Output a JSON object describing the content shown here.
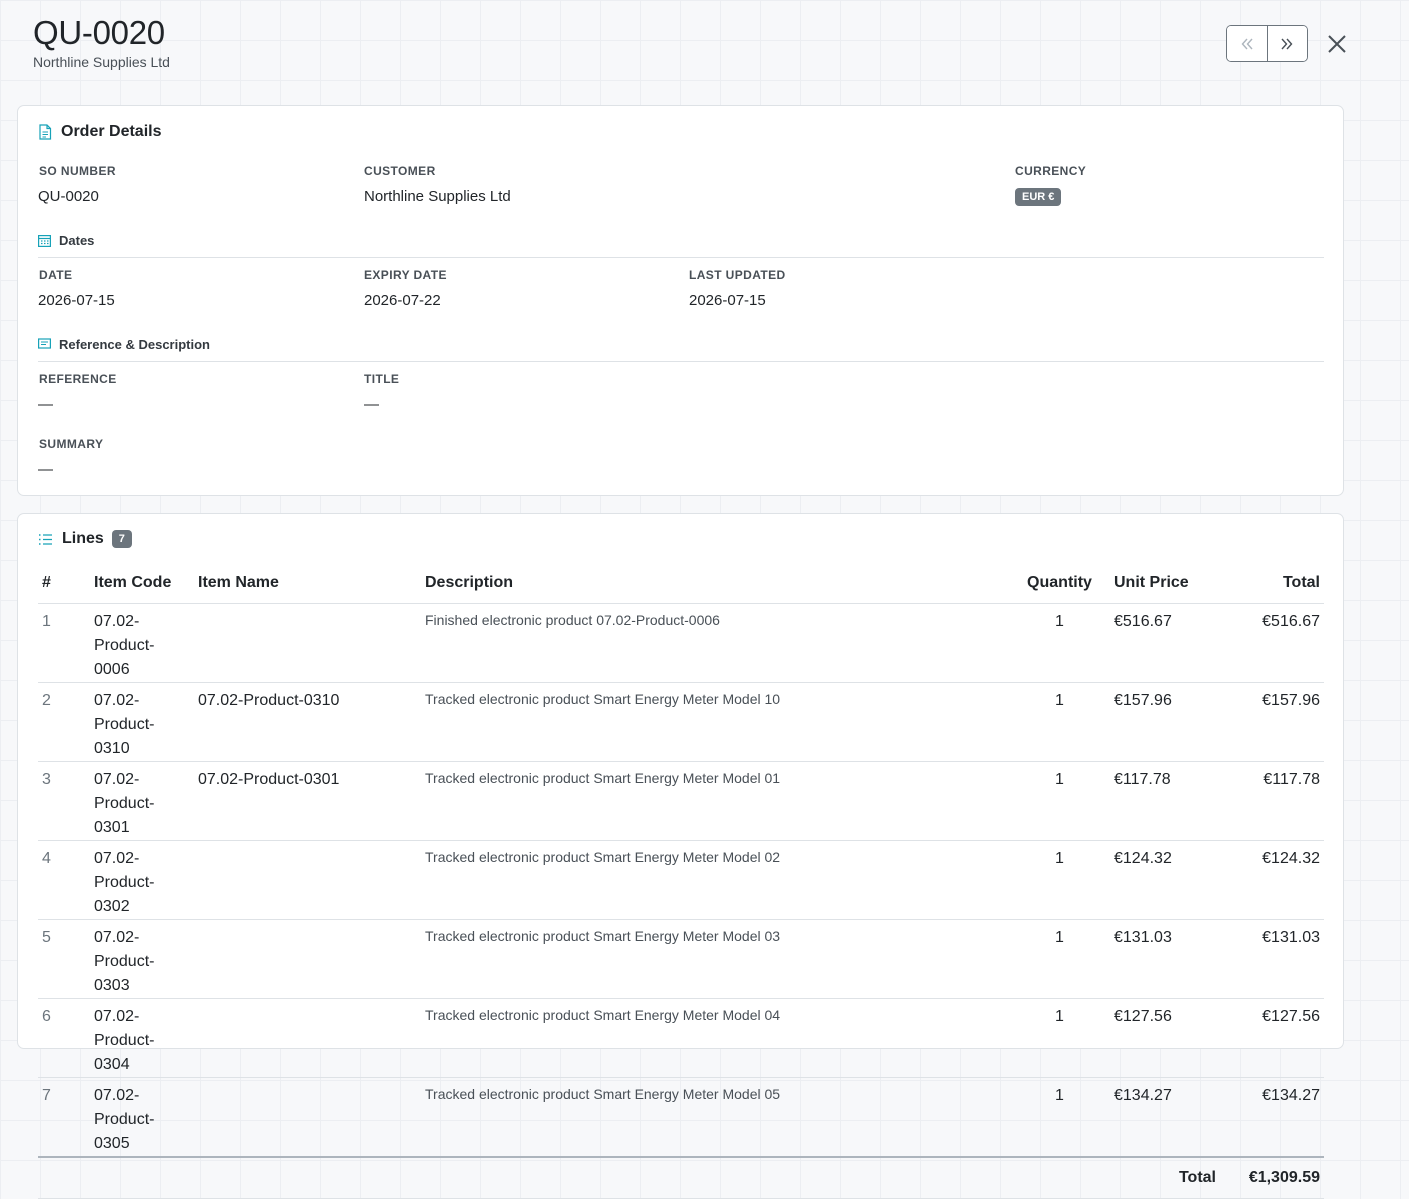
{
  "header": {
    "title": "QU-0020",
    "subtitle": "Northline Supplies Ltd"
  },
  "icons": {
    "prev": "chevrons-left-icon",
    "next": "chevrons-right-icon",
    "close": "close-icon",
    "order_details": "document-icon",
    "dates": "calendar-icon",
    "reference": "message-icon",
    "lines": "list-icon"
  },
  "colors": {
    "accent": "#17a2b8",
    "badge": "#6c757d"
  },
  "order_details": {
    "title": "Order Details",
    "so_number": {
      "label": "SO NUMBER",
      "value": "QU-0020"
    },
    "customer": {
      "label": "CUSTOMER",
      "value": "Northline Supplies Ltd"
    },
    "currency": {
      "label": "CURRENCY",
      "value": "EUR €"
    },
    "dates": {
      "title": "Dates",
      "date": {
        "label": "DATE",
        "value": "2026-07-15"
      },
      "expiry": {
        "label": "EXPIRY DATE",
        "value": "2026-07-22"
      },
      "updated": {
        "label": "LAST UPDATED",
        "value": "2026-07-15"
      }
    },
    "reference_section": {
      "title": "Reference & Description",
      "reference": {
        "label": "REFERENCE",
        "value": "—"
      },
      "title_field": {
        "label": "TITLE",
        "value": "—"
      },
      "summary": {
        "label": "SUMMARY",
        "value": "—"
      }
    }
  },
  "lines": {
    "title": "Lines",
    "count": "7",
    "columns": [
      "#",
      "Item Code",
      "Item Name",
      "Description",
      "Quantity",
      "Unit Price",
      "Total"
    ],
    "rows": [
      {
        "num": "1",
        "code": "07.02-Product-0006",
        "name": "",
        "desc": "Finished electronic product 07.02-Product-0006",
        "qty": "1",
        "price": "€516.67",
        "total": "€516.67"
      },
      {
        "num": "2",
        "code": "07.02-Product-0310",
        "name": "07.02-Product-0310",
        "desc": "Tracked electronic product Smart Energy Meter Model 10",
        "qty": "1",
        "price": "€157.96",
        "total": "€157.96"
      },
      {
        "num": "3",
        "code": "07.02-Product-0301",
        "name": "07.02-Product-0301",
        "desc": "Tracked electronic product Smart Energy Meter Model 01",
        "qty": "1",
        "price": "€117.78",
        "total": "€117.78"
      },
      {
        "num": "4",
        "code": "07.02-Product-0302",
        "name": "",
        "desc": "Tracked electronic product Smart Energy Meter Model 02",
        "qty": "1",
        "price": "€124.32",
        "total": "€124.32"
      },
      {
        "num": "5",
        "code": "07.02-Product-0303",
        "name": "",
        "desc": "Tracked electronic product Smart Energy Meter Model 03",
        "qty": "1",
        "price": "€131.03",
        "total": "€131.03"
      },
      {
        "num": "6",
        "code": "07.02-Product-0304",
        "name": "",
        "desc": "Tracked electronic product Smart Energy Meter Model 04",
        "qty": "1",
        "price": "€127.56",
        "total": "€127.56"
      },
      {
        "num": "7",
        "code": "07.02-Product-0305",
        "name": "",
        "desc": "Tracked electronic product Smart Energy Meter Model 05",
        "qty": "1",
        "price": "€134.27",
        "total": "€134.27"
      }
    ],
    "total_label": "Total",
    "total_value": "€1,309.59"
  }
}
